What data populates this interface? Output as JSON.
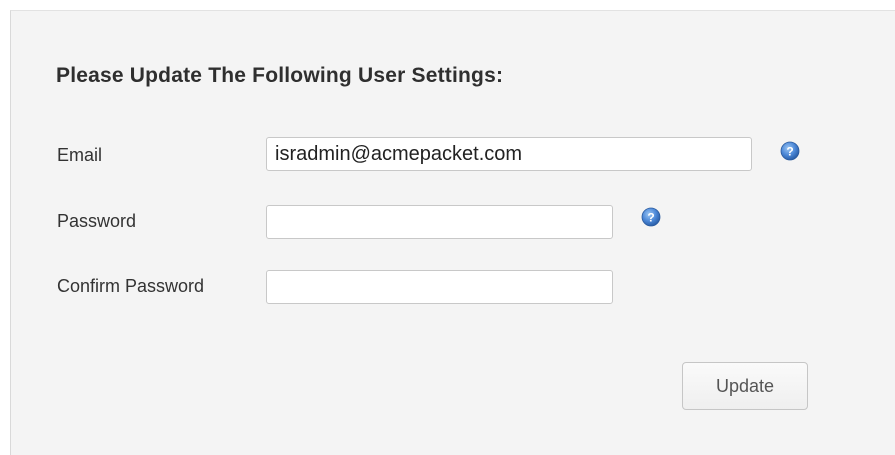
{
  "form": {
    "heading": "Please Update The Following User Settings:",
    "email": {
      "label": "Email",
      "value": "isradmin@acmepacket.com",
      "help_icon": "help-question-icon"
    },
    "password": {
      "label": "Password",
      "value": "",
      "help_icon": "help-question-icon"
    },
    "confirm_password": {
      "label": "Confirm Password",
      "value": ""
    },
    "update_label": "Update"
  },
  "colors": {
    "panel_background": "#f4f4f4",
    "help_icon_blue": "#3f7fd1"
  }
}
